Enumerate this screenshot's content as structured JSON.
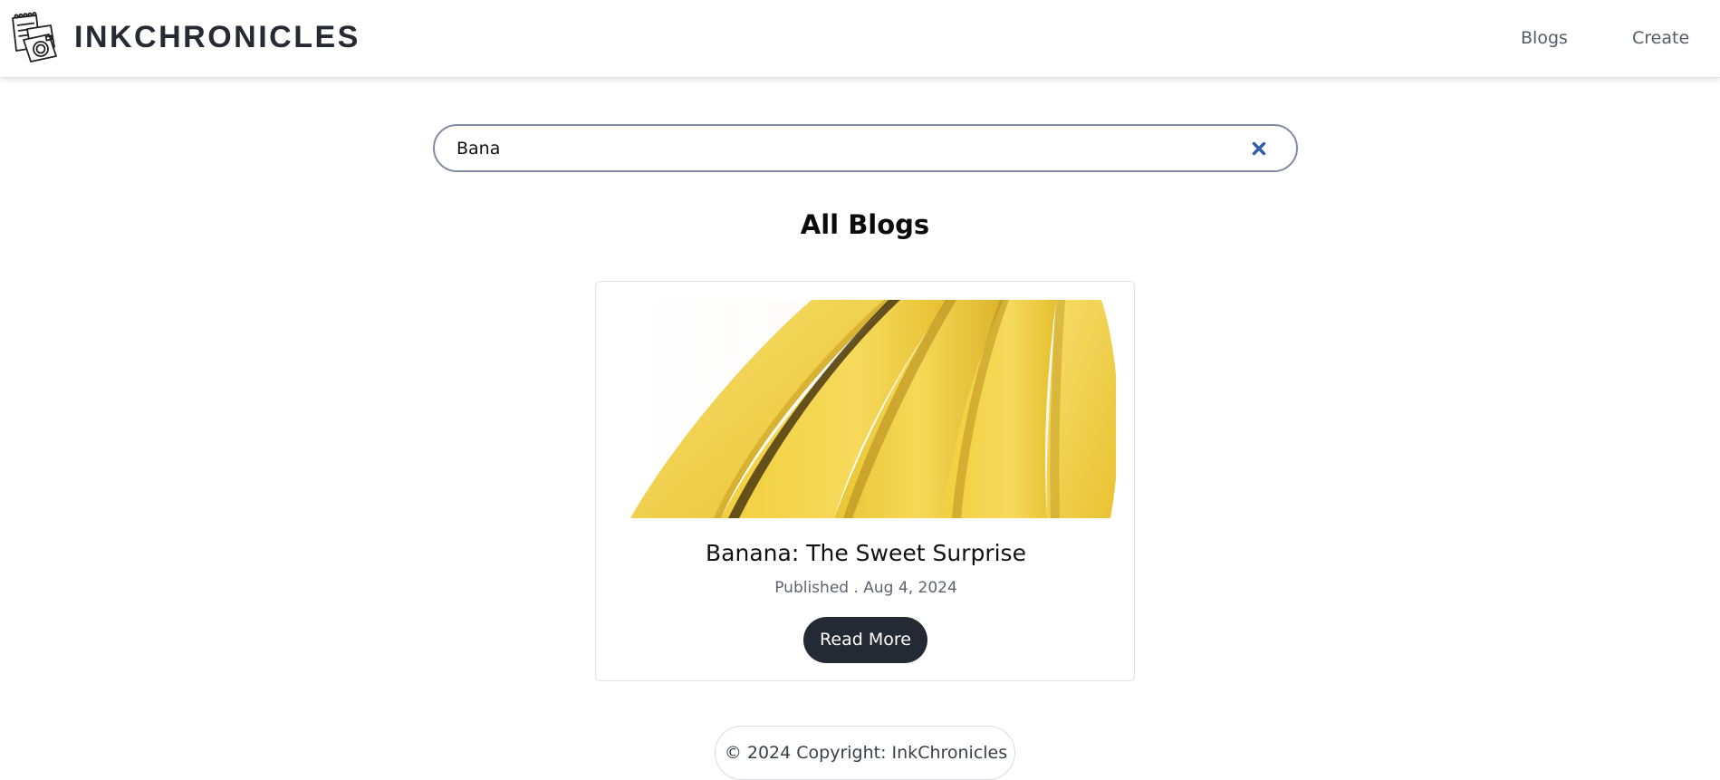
{
  "header": {
    "brand": "INKCHRONICLES",
    "logo_icon": "camera-notebook-icon",
    "nav": [
      {
        "label": "Blogs"
      },
      {
        "label": "Create"
      }
    ]
  },
  "search": {
    "value": "Bana",
    "clear_icon": "close-icon",
    "accent_color": "#2f5fa8"
  },
  "main": {
    "title": "All Blogs",
    "cards": [
      {
        "image": "banana-photo",
        "title": "Banana: The Sweet Surprise",
        "date": "Published . Aug 4, 2024",
        "button_label": "Read More"
      }
    ]
  },
  "footer": {
    "text": "© 2024 Copyright: InkChronicles"
  },
  "colors": {
    "button_bg": "#232a33",
    "banana": "#f2cf3c"
  }
}
